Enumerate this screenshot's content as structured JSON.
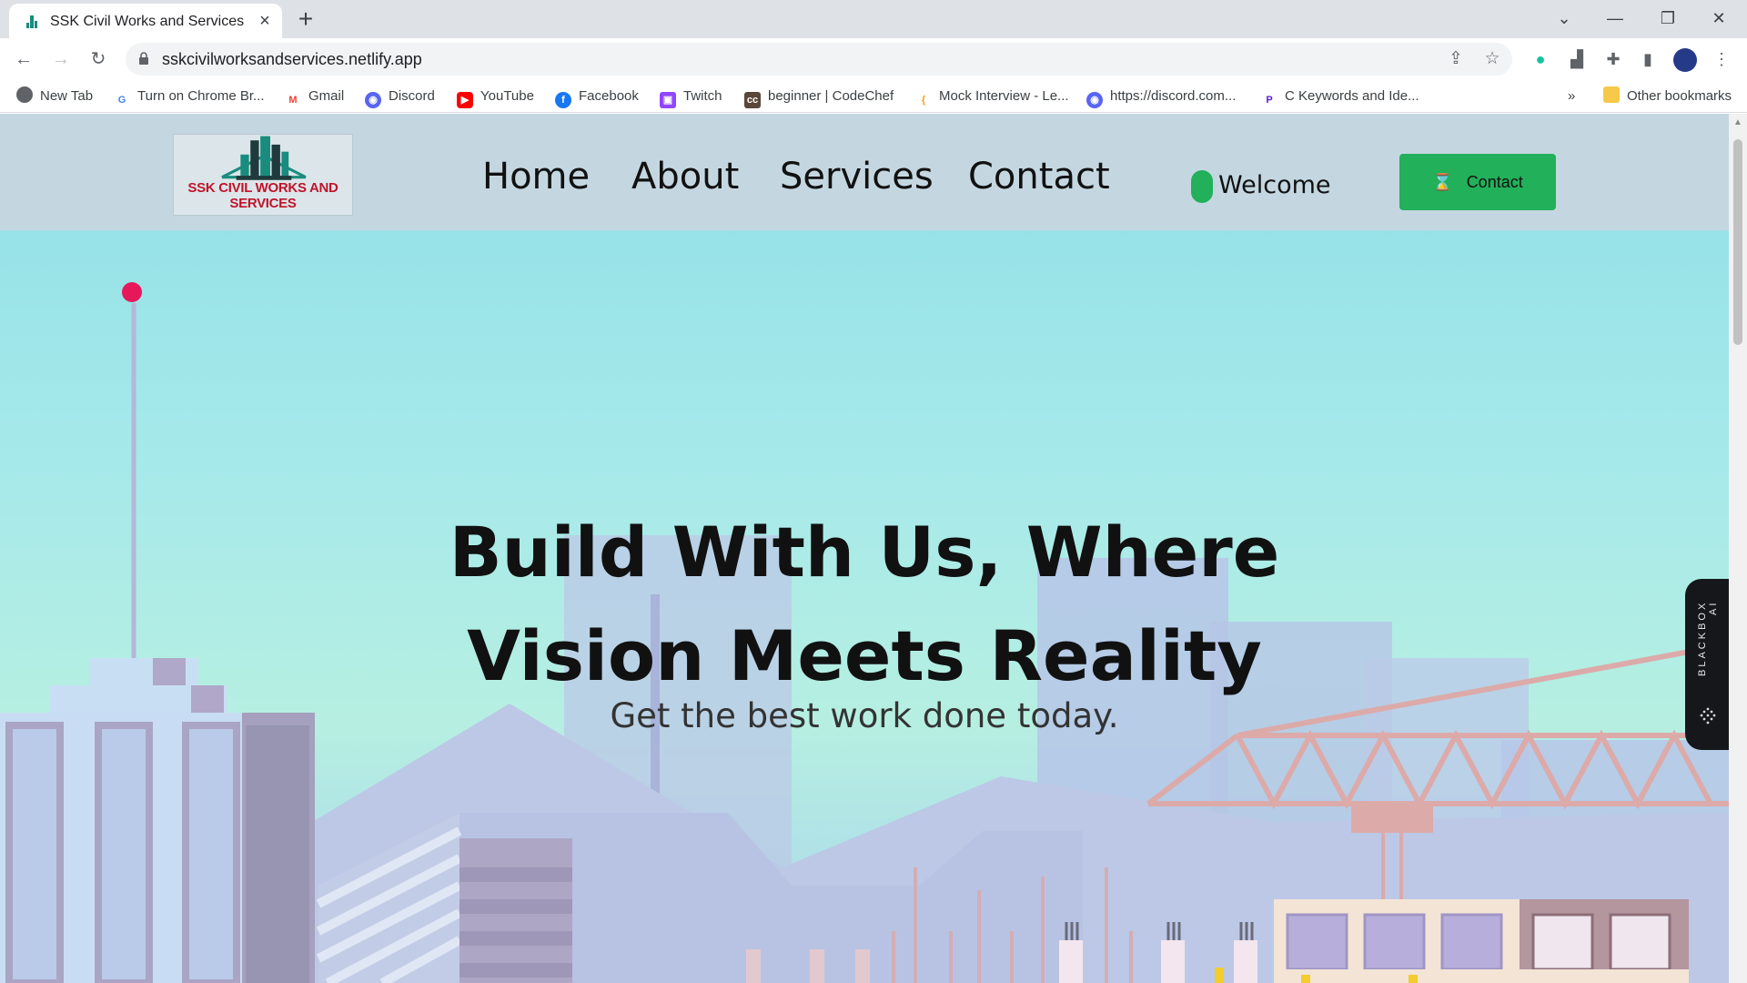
{
  "browser": {
    "tab_title": "SSK Civil Works and Services",
    "url": "sskcivilworksandservices.netlify.app",
    "bookmarks": [
      {
        "label": "New Tab",
        "icon": "globe-icon",
        "color": "#5f6368"
      },
      {
        "label": "Turn on Chrome Br...",
        "icon": "google-icon",
        "color": "#ea4335"
      },
      {
        "label": "Gmail",
        "icon": "gmail-icon",
        "color": "#ea4335"
      },
      {
        "label": "Discord",
        "icon": "discord-icon",
        "color": "#5865f2"
      },
      {
        "label": "YouTube",
        "icon": "youtube-icon",
        "color": "#ff0000"
      },
      {
        "label": "Facebook",
        "icon": "facebook-icon",
        "color": "#1877f2"
      },
      {
        "label": "Twitch",
        "icon": "twitch-icon",
        "color": "#9146ff"
      },
      {
        "label": "beginner | CodeChef",
        "icon": "codechef-icon",
        "color": "#5b4638"
      },
      {
        "label": "Mock Interview - Le...",
        "icon": "leetcode-icon",
        "color": "#f89f1b"
      },
      {
        "label": "https://discord.com...",
        "icon": "discord-icon",
        "color": "#5865f2"
      },
      {
        "label": "C Keywords and Ide...",
        "icon": "programiz-icon",
        "color": "#5a1ee6"
      }
    ],
    "overflow_label": "»",
    "other_bookmarks": "Other bookmarks"
  },
  "site": {
    "logo_text": "SSK CIVIL WORKS AND SERVICES",
    "nav": [
      "Home",
      "About",
      "Services",
      "Contact"
    ],
    "welcome": "Welcome",
    "contact_button": "Contact",
    "contact_icon": "⌛"
  },
  "hero": {
    "title_line1": "Build With Us, Where",
    "title_line2": "Vision Meets Reality",
    "subtitle": "Get the best work done today."
  },
  "widget": {
    "label": "BLACKBOX AI"
  },
  "colors": {
    "accent_green": "#22b05a",
    "header_bg": "#c4d7e1",
    "sky_top": "#8fdfe6"
  }
}
